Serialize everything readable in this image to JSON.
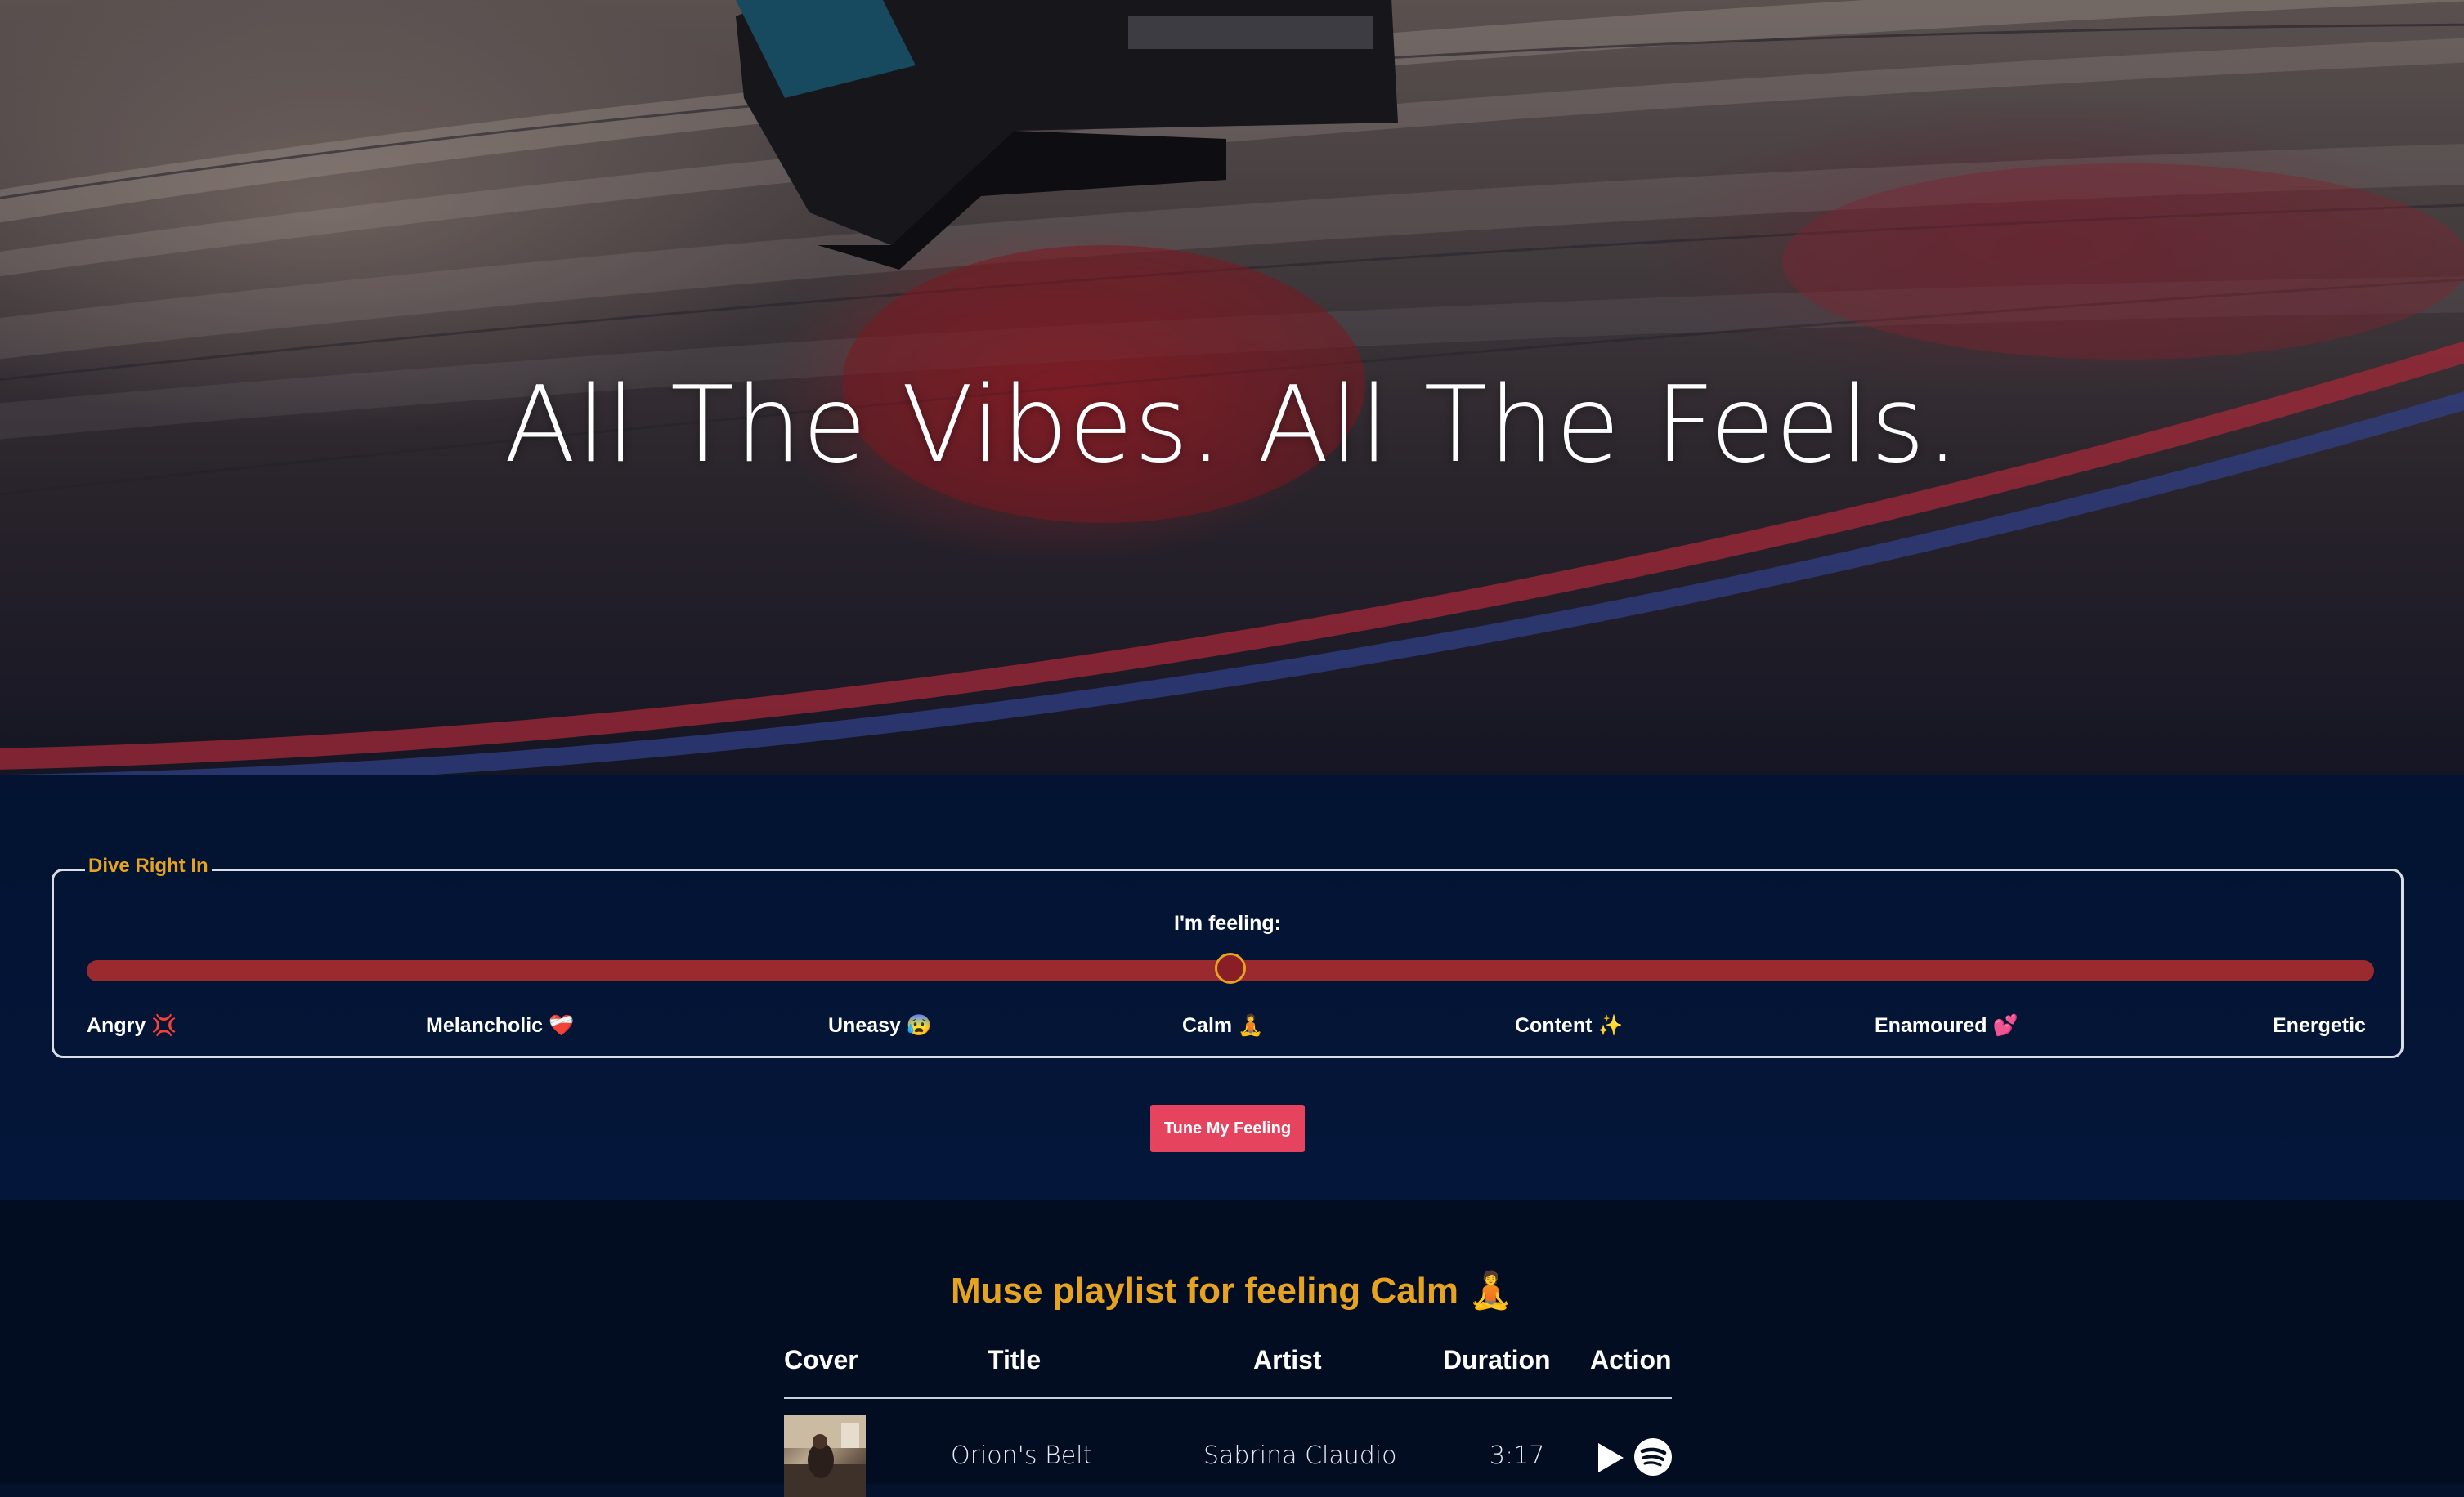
{
  "hero": {
    "title": "All The Vibes. All The Feels."
  },
  "mood_form": {
    "legend": "Dive Right In",
    "prompt": "I'm feeling:",
    "selected_index": 3,
    "options": [
      {
        "label": "Angry 💢"
      },
      {
        "label": "Melancholic ❤️‍🩹"
      },
      {
        "label": "Uneasy 😰"
      },
      {
        "label": "Calm 🧘"
      },
      {
        "label": "Content ✨"
      },
      {
        "label": "Enamoured 💕"
      },
      {
        "label": "Energetic"
      }
    ],
    "submit_label": "Tune My Feeling"
  },
  "playlist": {
    "heading": "Muse playlist for feeling Calm 🧘",
    "columns": [
      "Cover",
      "Title",
      "Artist",
      "Duration",
      "Action"
    ],
    "tracks": [
      {
        "title": "Orion's Belt",
        "artist": "Sabrina Claudio",
        "duration": "3:17"
      }
    ]
  },
  "colors": {
    "accent": "#e6a320",
    "button": "#e6435f",
    "slider_track": "#9a2a2e",
    "background": "#04122b"
  },
  "icons": [
    "play-icon",
    "spotify-icon"
  ]
}
